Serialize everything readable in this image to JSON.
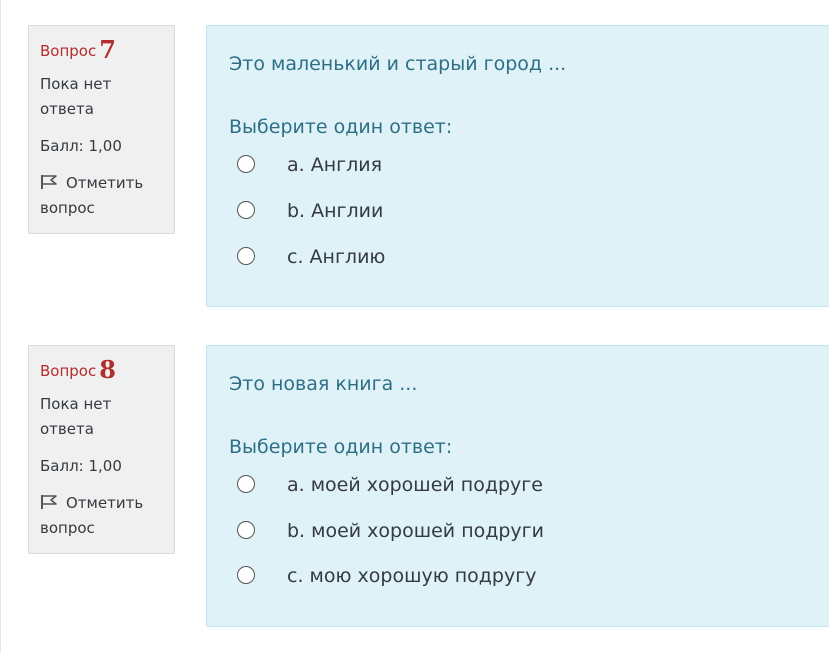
{
  "questions": [
    {
      "label": "Вопрос",
      "number": "7",
      "state": "Пока нет ответа",
      "grade": "Балл: 1,00",
      "flag_label": "Отметить вопрос",
      "text": "Это маленький и старый город ...",
      "prompt": "Выберите один ответ:",
      "options": [
        "a. Англия",
        "b. Англии",
        "c. Англию"
      ]
    },
    {
      "label": "Вопрос",
      "number": "8",
      "state": "Пока нет ответа",
      "grade": "Балл: 1,00",
      "flag_label": "Отметить вопрос",
      "text": "Это новая книга ...",
      "prompt": "Выберите один ответ:",
      "options": [
        "a. моей хорошей подруге",
        "b. моей хорошей подруги",
        "c. мою хорошую подругу"
      ]
    }
  ],
  "colors": {
    "question_number": "#b32d2d",
    "content_background": "#def2f8",
    "content_border": "#bfe6f1",
    "info_background": "#f0f0f0",
    "question_text": "#2e6f87"
  },
  "icons": {
    "flag": "flag-icon",
    "radio": "radio-unchecked"
  }
}
